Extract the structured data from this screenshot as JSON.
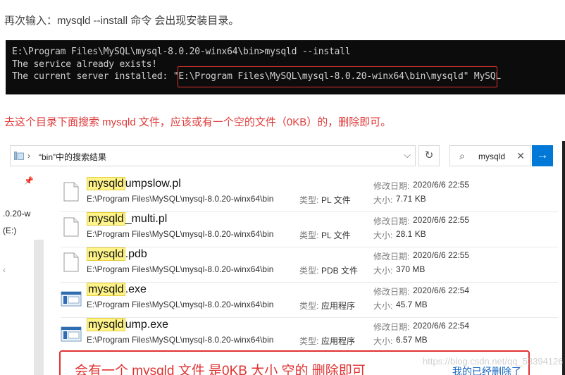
{
  "intro_text": "再次输入：mysqld --install 命令  会出现安装目录。",
  "terminal": {
    "lines": [
      "E:\\Program Files\\MySQL\\mysql-8.0.20-winx64\\bin>mysqld --install",
      "The service already exists!",
      "The current server installed: \"E:\\Program Files\\MySQL\\mysql-8.0.20-winx64\\bin\\mysqld\" MySQL"
    ]
  },
  "note_text": "去这个目录下面搜索 mysqld 文件，应该或有一个空的文件（0KB）的，删除即可。",
  "explorer": {
    "address_text": "“bin”中的搜索结果",
    "search_value": "mysqld",
    "nav_items": [
      ".0.20-w",
      "(E:)",
      "‹"
    ],
    "type_label": "类型:",
    "date_label": "修改日期:",
    "size_label": "大小:",
    "files": [
      {
        "match": "mysqld",
        "rest": "umpslow.pl",
        "path": "E:\\Program Files\\MySQL\\mysql-8.0.20-winx64\\bin",
        "type": "PL 文件",
        "date": "2020/6/6 22:55",
        "size": "7.71 KB",
        "icon": "document-file-icon"
      },
      {
        "match": "mysqld",
        "rest": "_multi.pl",
        "path": "E:\\Program Files\\MySQL\\mysql-8.0.20-winx64\\bin",
        "type": "PL 文件",
        "date": "2020/6/6 22:55",
        "size": "28.1 KB",
        "icon": "document-file-icon"
      },
      {
        "match": "mysqld",
        "rest": ".pdb",
        "path": "E:\\Program Files\\MySQL\\mysql-8.0.20-winx64\\bin",
        "type": "PDB 文件",
        "date": "2020/6/6 22:55",
        "size": "370 MB",
        "icon": "document-file-icon"
      },
      {
        "match": "mysqld",
        "rest": ".exe",
        "path": "E:\\Program Files\\MySQL\\mysql-8.0.20-winx64\\bin",
        "type": "应用程序",
        "date": "2020/6/6 22:54",
        "size": "45.7 MB",
        "icon": "application-exe-icon"
      },
      {
        "match": "mysqld",
        "rest": "ump.exe",
        "path": "E:\\Program Files\\MySQL\\mysql-8.0.20-winx64\\bin",
        "type": "应用程序",
        "date": "2020/6/6 22:54",
        "size": "6.57 MB",
        "icon": "application-exe-icon"
      }
    ]
  },
  "callout": {
    "text": "会有一个 mysqld 文件  是0KB 大小     空的     删除即可",
    "link": "我的已经删除了"
  },
  "watermark": "https://blog.csdn.net/qq_53394126",
  "colors": {
    "accent_red": "#e03131",
    "highlight_yellow": "#fff489",
    "link_blue": "#1565c0",
    "button_blue": "#0078d7"
  }
}
